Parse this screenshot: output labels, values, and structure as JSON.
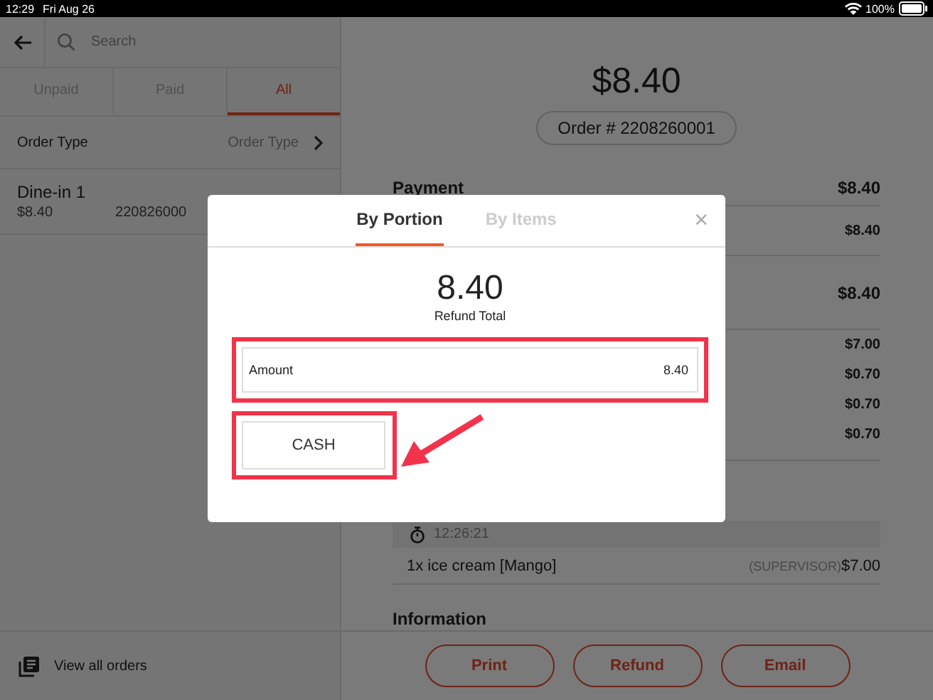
{
  "status_bar": {
    "time": "12:29",
    "date": "Fri Aug 26",
    "battery": "100%"
  },
  "sidebar": {
    "search": {
      "placeholder": "Search"
    },
    "tabs": [
      {
        "label": "Unpaid",
        "selected": false
      },
      {
        "label": "Paid",
        "selected": false
      },
      {
        "label": "All",
        "selected": true
      }
    ],
    "filter": {
      "label": "Order Type",
      "value": "Order Type"
    },
    "orders": [
      {
        "name": "Dine-in  1",
        "amount": "$8.40",
        "number": "220826000"
      }
    ],
    "footer": "View all orders"
  },
  "detail": {
    "total": "$8.40",
    "order_number": "Order # 2208260001",
    "rows": [
      {
        "kind": "header",
        "label": "Payment",
        "amount": "$8.40"
      },
      {
        "kind": "line",
        "amount": "$8.40"
      },
      {
        "kind": "total",
        "amount": "$8.40"
      },
      {
        "kind": "line",
        "amount": "$7.00"
      },
      {
        "kind": "line",
        "amount": "$0.70"
      },
      {
        "kind": "line",
        "amount": "$0.70"
      },
      {
        "kind": "line",
        "amount": "$0.70"
      },
      {
        "kind": "gap"
      },
      {
        "kind": "time",
        "label": "12:26:21"
      },
      {
        "kind": "item",
        "label": "1x ice cream  [Mango]",
        "note": "(SUPERVISOR)",
        "amount": "$7.00"
      },
      {
        "kind": "section",
        "label": "Information"
      }
    ],
    "buttons": [
      "Print",
      "Refund",
      "Email"
    ]
  },
  "modal": {
    "tabs": [
      {
        "label": "By Portion",
        "selected": true
      },
      {
        "label": "By Items",
        "selected": false
      }
    ],
    "close": "×",
    "amount": "8.40",
    "amount_caption": "Refund Total",
    "field": {
      "label": "Amount",
      "value": "8.40",
      "highlighted": true
    },
    "methods": [
      {
        "label": "CASH",
        "highlighted": true,
        "arrow": true
      }
    ]
  }
}
